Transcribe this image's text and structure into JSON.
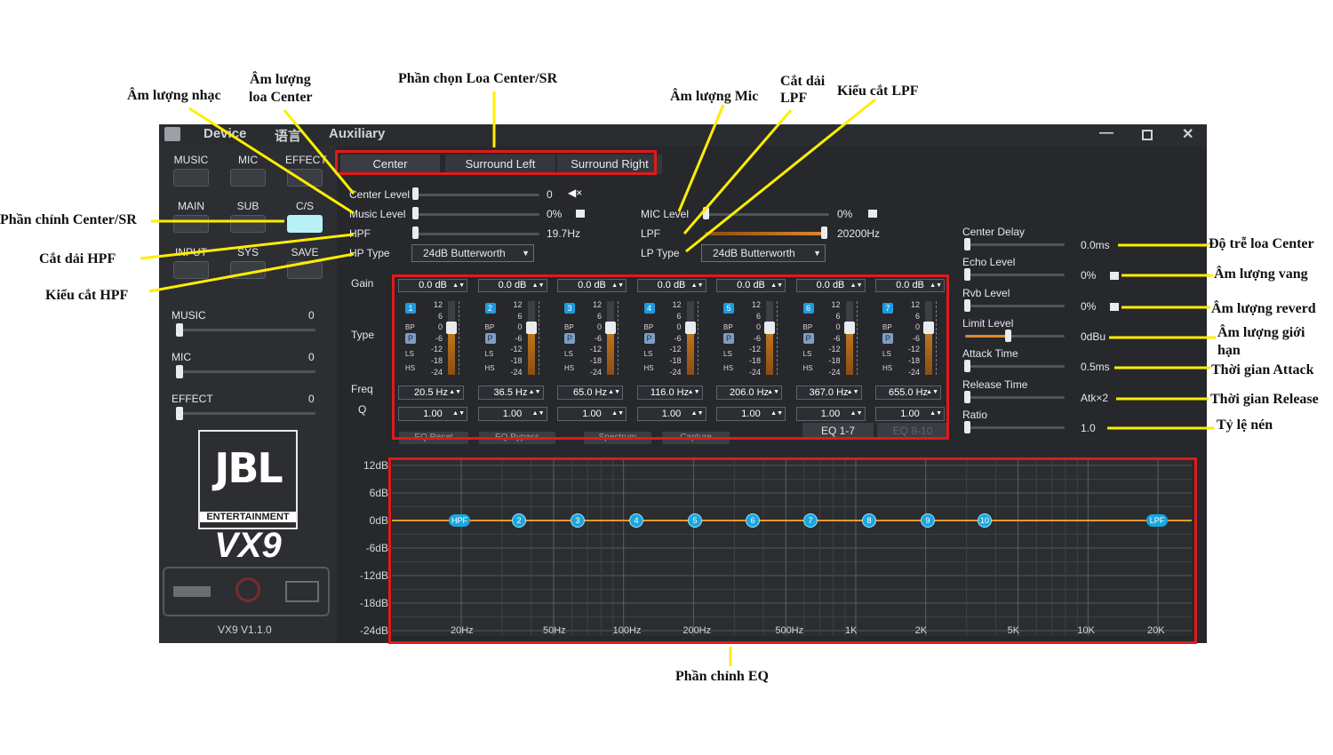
{
  "annotations": {
    "music_volume": "Âm lượng nhạc",
    "center_volume_1": "Âm lượng",
    "center_volume_2": "loa Center",
    "center_sr_select": "Phần chọn Loa Center/SR",
    "mic_volume": "Âm lượng Mic",
    "lpf_cut_1": "Cắt dải",
    "lpf_cut_2": "LPF",
    "lpf_type": "Kiểu cắt LPF",
    "center_sr_adjust": "Phần chỉnh Center/SR",
    "hpf_cut": "Cắt dải HPF",
    "hpf_type": "Kiểu cắt HPF",
    "center_delay": "Độ trễ loa Center",
    "echo_volume": "Âm lượng vang",
    "reverb_volume": "Âm lượng reverd",
    "limit_volume_1": "Âm lượng giới",
    "limit_volume_2": "hạn",
    "attack_time": "Thời gian Attack",
    "release_time": "Thời gian Release",
    "ratio": "Tỷ lệ nén",
    "eq_section": "Phần chỉnh EQ"
  },
  "titlebar": {
    "tab1": "Device",
    "tab2": "语言",
    "tab3": "Auxiliary"
  },
  "nav": {
    "music": "MUSIC",
    "mic": "MIC",
    "effect": "EFFECT",
    "main": "MAIN",
    "sub": "SUB",
    "cs": "C/S",
    "input": "INPUT",
    "sys": "SYS",
    "save": "SAVE"
  },
  "left_sliders": [
    {
      "label": "MUSIC",
      "value": "0"
    },
    {
      "label": "MIC",
      "value": "0"
    },
    {
      "label": "EFFECT",
      "value": "0"
    }
  ],
  "logo": {
    "brand": "JBL",
    "sub": "ENTERTAINMENT",
    "model": "VX9"
  },
  "version": "VX9 V1.1.0",
  "tabs": [
    "Center",
    "Surround Left",
    "Surround Right"
  ],
  "levels": {
    "center_label": "Center Level",
    "center_value": "0",
    "music_label": "Music Level",
    "music_value": "0%",
    "hpf_label": "HPF",
    "hpf_value": "19.7Hz",
    "hptype_label": "HP Type",
    "hptype_value": "24dB Butterworth",
    "mic_label": "MIC Level",
    "mic_value": "0%",
    "lpf_label": "LPF",
    "lpf_value": "20200Hz",
    "lptype_label": "LP Type",
    "lptype_value": "24dB Butterworth"
  },
  "eq_row_labels": {
    "gain": "Gain",
    "type": "Type",
    "freq": "Freq",
    "q": "Q"
  },
  "eq_type_labels": {
    "bp": "BP",
    "ls": "LS",
    "hs": "HS",
    "peak": "P"
  },
  "eq_scale": [
    "12",
    "6",
    "0",
    "-6",
    "-12",
    "-18",
    "-24"
  ],
  "bands": [
    {
      "num": "1",
      "gain": "0.0 dB",
      "freq": "20.5 Hz",
      "q": "1.00"
    },
    {
      "num": "2",
      "gain": "0.0 dB",
      "freq": "36.5 Hz",
      "q": "1.00"
    },
    {
      "num": "3",
      "gain": "0.0 dB",
      "freq": "65.0 Hz",
      "q": "1.00"
    },
    {
      "num": "4",
      "gain": "0.0 dB",
      "freq": "116.0 Hz",
      "q": "1.00"
    },
    {
      "num": "5",
      "gain": "0.0 dB",
      "freq": "206.0 Hz",
      "q": "1.00"
    },
    {
      "num": "6",
      "gain": "0.0 dB",
      "freq": "367.0 Hz",
      "q": "1.00"
    },
    {
      "num": "7",
      "gain": "0.0 dB",
      "freq": "655.0 Hz",
      "q": "1.00"
    }
  ],
  "eq_pages": {
    "page1": "EQ 1-7",
    "page2": "EQ 8-10"
  },
  "eq_buttons": [
    "EQ Reset",
    "EQ Bypass",
    "Spectrum",
    "Capture"
  ],
  "right_params": [
    {
      "label": "Center Delay",
      "value": "0.0ms"
    },
    {
      "label": "Echo Level",
      "value": "0%"
    },
    {
      "label": "Rvb Level",
      "value": "0%"
    },
    {
      "label": "Limit Level",
      "value": "0dBu"
    },
    {
      "label": "Attack Time",
      "value": "0.5ms"
    },
    {
      "label": "Release Time",
      "value": "Atk×2"
    },
    {
      "label": "Ratio",
      "value": "1.0"
    }
  ],
  "graph": {
    "y_labels": [
      "12dB",
      "6dB",
      "0dB",
      "-6dB",
      "-12dB",
      "-18dB",
      "-24dB"
    ],
    "x_labels": [
      "20Hz",
      "50Hz",
      "100Hz",
      "200Hz",
      "500Hz",
      "1K",
      "2K",
      "5K",
      "10K",
      "20K"
    ],
    "nodes": [
      "HPF",
      "2",
      "3",
      "4",
      "5",
      "6",
      "7",
      "8",
      "9",
      "10",
      "LPF"
    ]
  },
  "colors": {
    "accent": "#1aa7df",
    "highlight_red": "#e01a1a",
    "annotation_yellow": "#ffee00",
    "eq_curve": "#e59a2a",
    "active_nav": "#b8f0f7"
  }
}
